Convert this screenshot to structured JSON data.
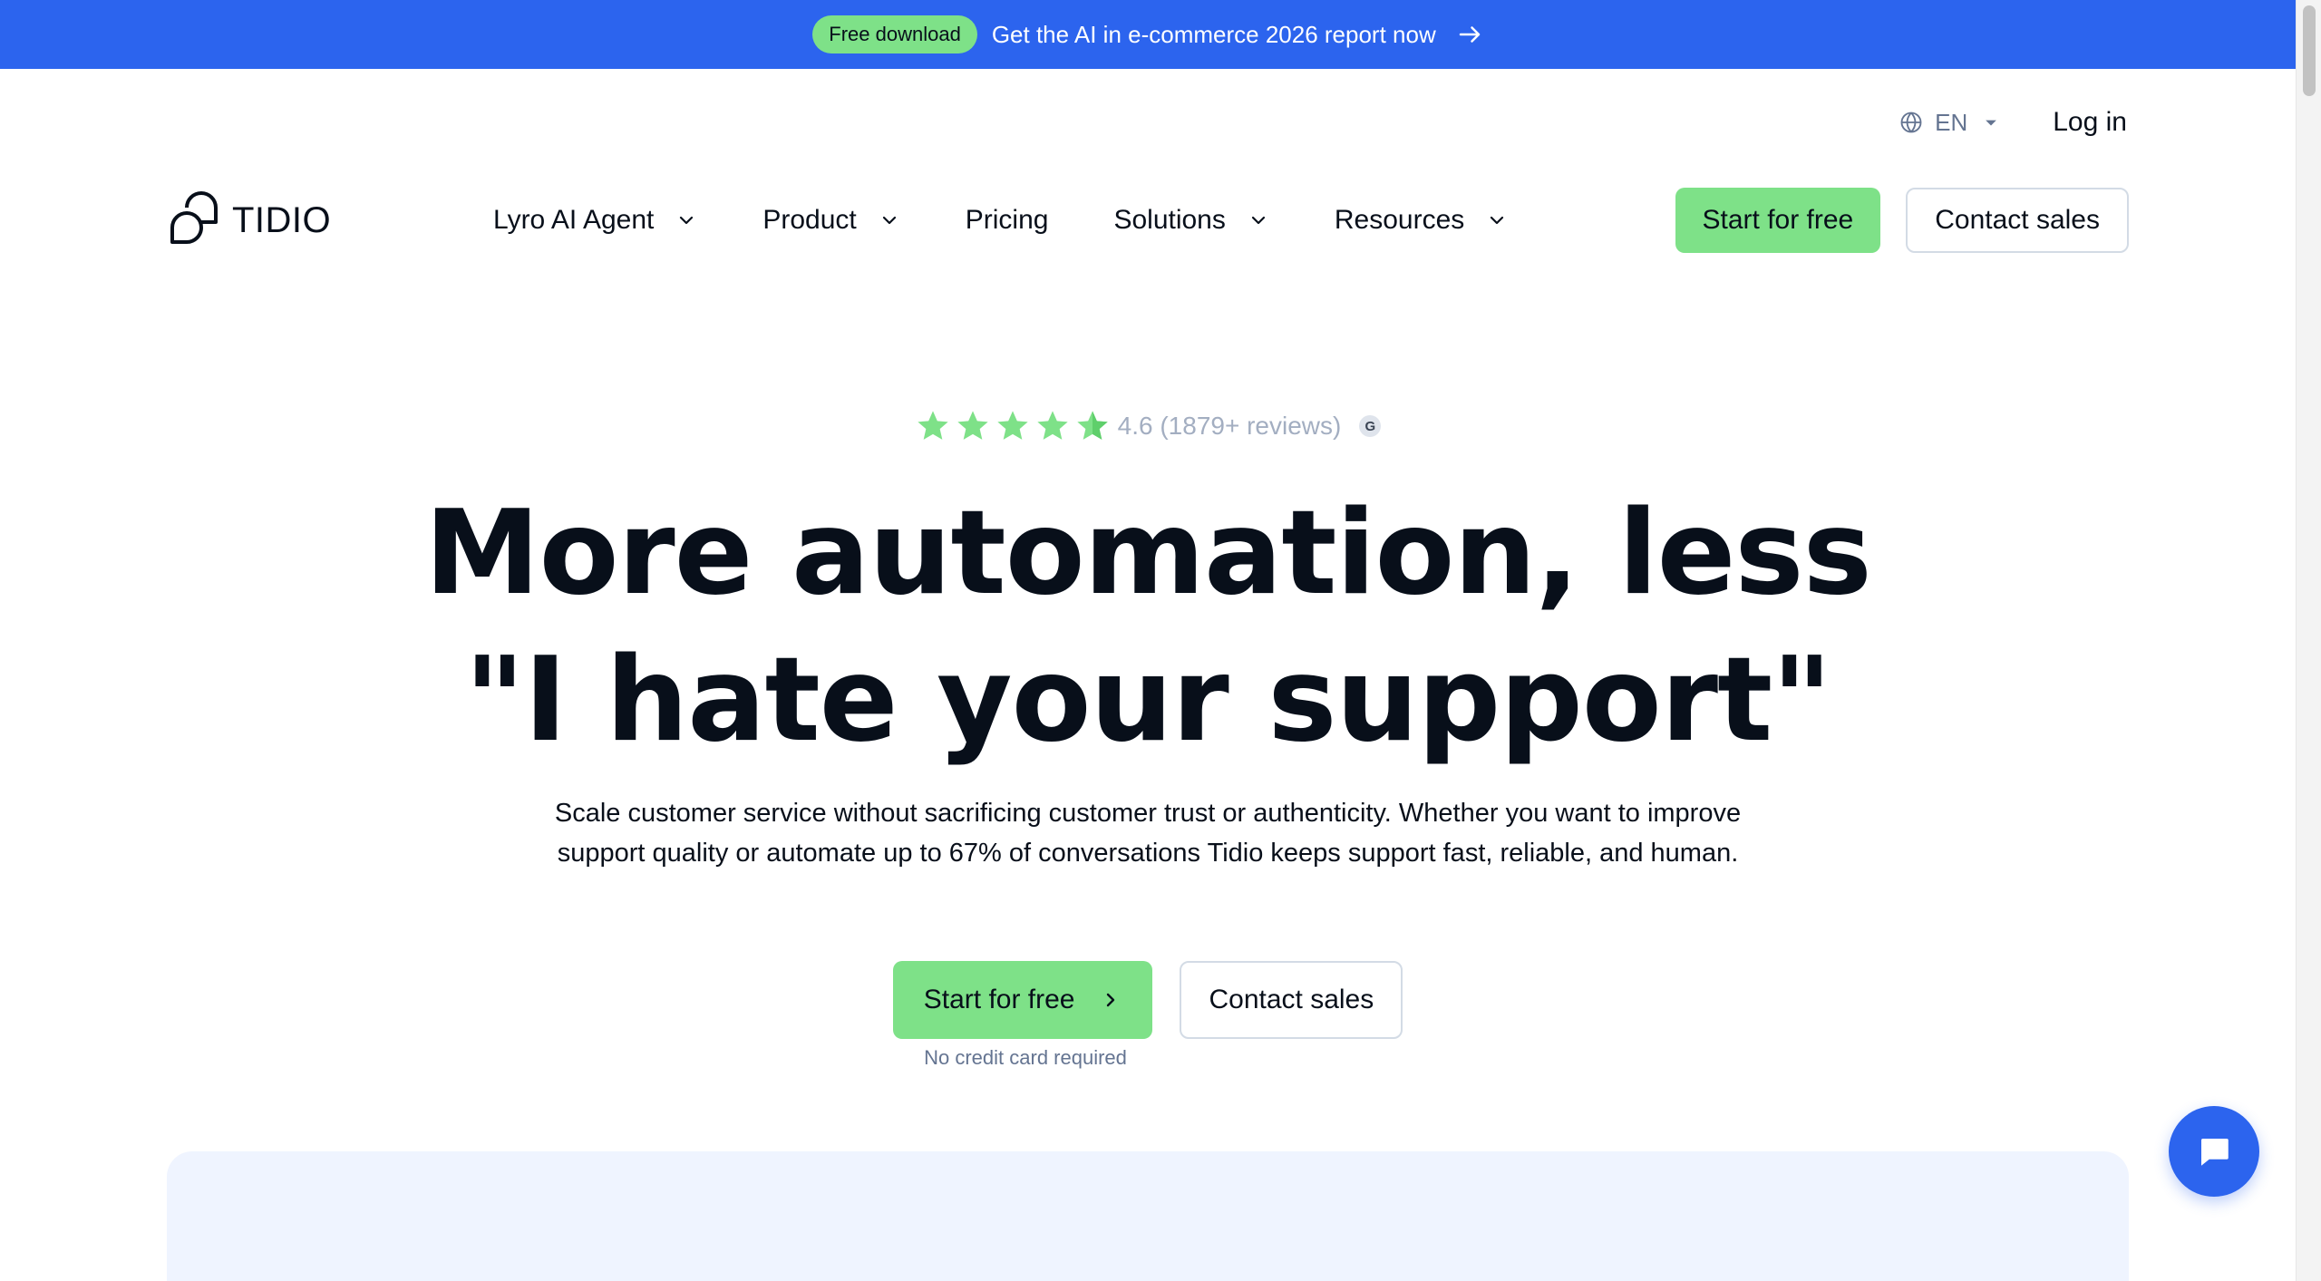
{
  "announcement": {
    "badge": "Free download",
    "text": "Get the AI in e-commerce 2026 report now",
    "arrow_icon": "arrow-right-icon"
  },
  "utility": {
    "language": "EN",
    "login": "Log in"
  },
  "brand": {
    "name": "TIDIO"
  },
  "nav": {
    "items": [
      {
        "label": "Lyro AI Agent",
        "has_dropdown": true
      },
      {
        "label": "Product",
        "has_dropdown": true
      },
      {
        "label": "Pricing",
        "has_dropdown": false
      },
      {
        "label": "Solutions",
        "has_dropdown": true
      },
      {
        "label": "Resources",
        "has_dropdown": true
      }
    ],
    "start_free": "Start for free",
    "contact_sales": "Contact sales"
  },
  "hero": {
    "rating_value": "4.6",
    "rating_text": "4.6 (1879+ reviews)",
    "stars": 5,
    "review_source_icon": "g2-icon",
    "headline_line1": "More automation, less",
    "headline_line2": "\"I hate your support\"",
    "subtext_line1": "Scale customer service without sacrificing customer trust or authenticity. Whether you want to improve",
    "subtext_line2": "support quality or automate up to 67% of conversations Tidio keeps support fast, reliable, and human.",
    "cta_primary": "Start for free",
    "cta_secondary": "Contact sales",
    "no_credit_card": "No credit card required"
  },
  "colors": {
    "accent_blue": "#2c64ee",
    "accent_green": "#7ee188",
    "text_dark": "#080f1a",
    "text_muted": "#647491"
  }
}
